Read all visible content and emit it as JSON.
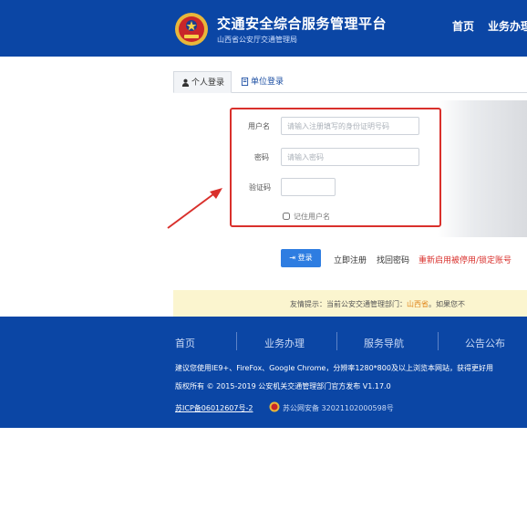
{
  "header": {
    "title": "交通安全综合服务管理平台",
    "subtitle": "山西省公安厅交通管理局",
    "nav": [
      "首页",
      "业务办理"
    ]
  },
  "tabs": [
    {
      "label": "个人登录",
      "icon": "user-icon",
      "active": true
    },
    {
      "label": "单位登录",
      "icon": "document-icon",
      "active": false
    }
  ],
  "form": {
    "username_label": "用户名",
    "username_placeholder": "请输入注册填写的身份证明号码",
    "password_label": "密码",
    "password_placeholder": "请输入密码",
    "captcha_label": "验证码",
    "captcha_value": "",
    "remember_label": "记住用户名",
    "remember_checked": false
  },
  "actions": {
    "login_label": "登录",
    "register_label": "立即注册",
    "recover_label": "找回密码",
    "reenable_label": "重新启用被停用/锁定账号"
  },
  "notice": {
    "prefix": "友情提示：当前公安交通管理部门：",
    "region": "山西省",
    "suffix": "。如果您不"
  },
  "footer": {
    "nav": [
      "首页",
      "业务办理",
      "服务导航",
      "公告公布"
    ],
    "browser_tip": "建议您使用IE9+、FireFox、Google Chrome，分辨率1280*800及以上浏览本网站，获得更好用",
    "copyright": "版权所有 © 2015-2019 公安机关交通管理部门官方发布 V1.17.0",
    "icp": "苏ICP备06012607号-2",
    "police_record": "苏公网安备 32021102000598号"
  },
  "colors": {
    "primary_blue": "#0b46a5",
    "highlight_red": "#d9302c",
    "button_blue": "#2e7de1",
    "notice_bg": "#fbf5cf"
  }
}
